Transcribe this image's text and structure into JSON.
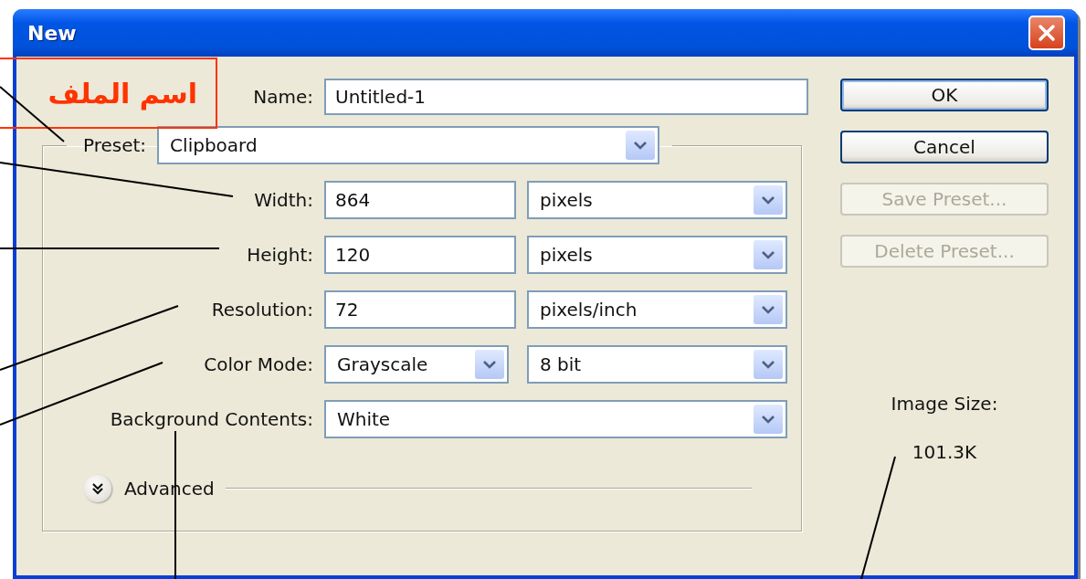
{
  "window": {
    "title": "New"
  },
  "name": {
    "label": "Name:",
    "value": "Untitled-1"
  },
  "preset": {
    "label": "Preset:",
    "value": "Clipboard"
  },
  "fields": [
    {
      "kind": "value_unit",
      "label": "Width:",
      "value": "864",
      "unit": "pixels"
    },
    {
      "kind": "value_unit",
      "label": "Height:",
      "value": "120",
      "unit": "pixels"
    },
    {
      "kind": "value_unit",
      "label": "Resolution:",
      "value": "72",
      "unit": "pixels/inch"
    },
    {
      "kind": "two_selects",
      "label": "Color Mode:",
      "value": "Grayscale",
      "unit": "8 bit"
    },
    {
      "kind": "select",
      "label": "Background Contents:",
      "value": "White"
    }
  ],
  "advanced": {
    "label": "Advanced",
    "expanded": false
  },
  "buttons": [
    {
      "label": "OK",
      "disabled": false,
      "default": true
    },
    {
      "label": "Cancel",
      "disabled": false,
      "default": false
    },
    {
      "label": "Save Preset...",
      "disabled": true,
      "default": false
    },
    {
      "label": "Delete Preset...",
      "disabled": true,
      "default": false
    }
  ],
  "image_size": {
    "label": "Image Size:",
    "value": "101.3K"
  },
  "callout": {
    "text": "اسم الملف"
  }
}
